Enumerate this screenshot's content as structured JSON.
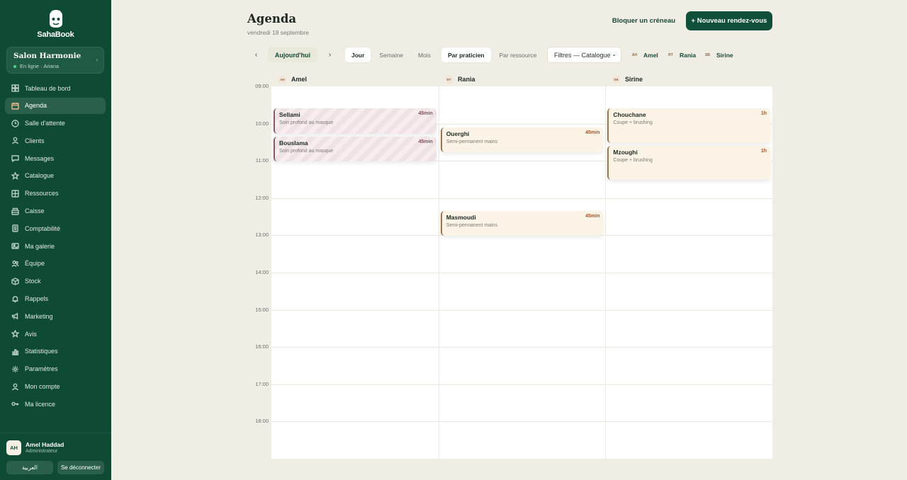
{
  "brand": {
    "name": "SahaBook"
  },
  "salon": {
    "name": "Salon Harmonie",
    "status": "En ligne · Ariana"
  },
  "nav": [
    {
      "label": "Tableau de bord",
      "icon": "dashboard-icon",
      "active": false
    },
    {
      "label": "Agenda",
      "icon": "calendar-icon",
      "active": true
    },
    {
      "label": "Salle d'attente",
      "icon": "clock-icon",
      "active": false
    },
    {
      "label": "Clients",
      "icon": "user-icon",
      "active": false
    },
    {
      "label": "Messages",
      "icon": "message-icon",
      "active": false
    },
    {
      "label": "Catalogue",
      "icon": "star-icon",
      "active": false
    },
    {
      "label": "Ressources",
      "icon": "grid-icon",
      "active": false
    },
    {
      "label": "Caisse",
      "icon": "cash-register-icon",
      "active": false
    },
    {
      "label": "Comptabilité",
      "icon": "ledger-icon",
      "active": false
    },
    {
      "label": "Ma galerie",
      "icon": "image-icon",
      "active": false
    },
    {
      "label": "Équipe",
      "icon": "team-icon",
      "active": false
    },
    {
      "label": "Stock",
      "icon": "box-icon",
      "active": false
    },
    {
      "label": "Rappels",
      "icon": "bell-icon",
      "active": false
    },
    {
      "label": "Marketing",
      "icon": "megaphone-icon",
      "active": false
    },
    {
      "label": "Avis",
      "icon": "star-outline-icon",
      "active": false
    },
    {
      "label": "Statistiques",
      "icon": "bar-chart-icon",
      "active": false
    },
    {
      "label": "Paramètres",
      "icon": "gear-icon",
      "active": false
    },
    {
      "label": "Mon compte",
      "icon": "account-icon",
      "active": false
    },
    {
      "label": "Ma licence",
      "icon": "key-icon",
      "active": false
    }
  ],
  "user": {
    "initials": "AH",
    "name": "Amel Haddad",
    "role": "Administrateur",
    "lang_button": "العربية",
    "logout_button": "Se déconnecter"
  },
  "header": {
    "title": "Agenda",
    "date": "vendredi 18 septembre",
    "block_button": "Bloquer un créneau",
    "new_button": "+ Nouveau rendez-vous"
  },
  "toolbar": {
    "prev": "‹",
    "next": "›",
    "today": "Aujourd'hui",
    "views": [
      {
        "label": "Jour",
        "active": true
      },
      {
        "label": "Semaine",
        "active": false
      },
      {
        "label": "Mois",
        "active": false
      }
    ],
    "groupings": [
      {
        "label": "Par praticien",
        "active": true
      },
      {
        "label": "Par ressource",
        "active": false
      }
    ],
    "filter": "Filtres — Catalogue",
    "staff_legend": [
      {
        "initials": "AH",
        "name": "Amel"
      },
      {
        "initials": "RT",
        "name": "Rania"
      },
      {
        "initials": "SB",
        "name": "Sirine"
      }
    ]
  },
  "calendar": {
    "hours": [
      "09:00",
      "10:00",
      "11:00",
      "12:00",
      "13:00",
      "14:00",
      "15:00",
      "16:00",
      "17:00",
      "18:00"
    ],
    "columns": [
      {
        "initials": "AH",
        "name": "Amel"
      },
      {
        "initials": "RT",
        "name": "Rania"
      },
      {
        "initials": "SB",
        "name": "Sirine"
      }
    ],
    "appointments": [
      {
        "column": 0,
        "client": "Sellami",
        "service": "Soin profond au masque",
        "duration": "45min",
        "start_hour": 9.5,
        "length_hours": 0.75,
        "style": "pink"
      },
      {
        "column": 0,
        "client": "Bouslama",
        "service": "Soin profond au masque",
        "duration": "45min",
        "start_hour": 10.25,
        "length_hours": 0.75,
        "style": "pink"
      },
      {
        "column": 1,
        "client": "Ouerghi",
        "service": "Semi-permanent mains",
        "duration": "45min",
        "start_hour": 10.0,
        "length_hours": 0.75,
        "style": "cream"
      },
      {
        "column": 1,
        "client": "Masmoudi",
        "service": "Semi-permanent mains",
        "duration": "45min",
        "start_hour": 12.25,
        "length_hours": 0.75,
        "style": "cream"
      },
      {
        "column": 2,
        "client": "Chouchane",
        "service": "Coupe + brushing",
        "duration": "1h",
        "start_hour": 9.5,
        "length_hours": 1.0,
        "style": "cream"
      },
      {
        "column": 2,
        "client": "Mzoughi",
        "service": "Coupe + brushing",
        "duration": "1h",
        "start_hour": 10.5,
        "length_hours": 1.0,
        "style": "cream"
      }
    ]
  },
  "colors": {
    "sidebar": "#0f4a35",
    "accent": "#10503a",
    "background": "#f0ede5"
  }
}
